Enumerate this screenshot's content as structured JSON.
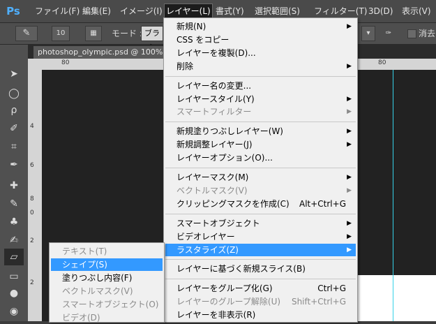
{
  "app": {
    "logo": "Ps"
  },
  "menubar": [
    {
      "label": "ファイル(F)",
      "left": 0
    },
    {
      "label": "編集(E)"
    },
    {
      "label": "イメージ(I)"
    },
    {
      "label": "レイヤー(L)",
      "active": true
    },
    {
      "label": "書式(Y)"
    },
    {
      "label": "選択範囲(S)"
    },
    {
      "label": "フィルター(T)"
    },
    {
      "label": "3D(D)"
    },
    {
      "label": "表示(V)"
    }
  ],
  "options": {
    "brush_size": "10",
    "mode_label": "モード :",
    "mode_value": "ブラシ",
    "erase_label": "消去"
  },
  "document_tab": {
    "title": "photoshop_olympic.psd @ 100%"
  },
  "ruler": {
    "h_left": "80",
    "h_right": "80",
    "v_marks": [
      "4",
      "6",
      "8",
      "0",
      "2",
      "2"
    ]
  },
  "layer_menu": [
    {
      "label": "新規(N)",
      "arrow": true
    },
    {
      "label": "CSS をコピー"
    },
    {
      "label": "レイヤーを複製(D)..."
    },
    {
      "label": "削除",
      "arrow": true
    },
    {
      "sep": true
    },
    {
      "label": "レイヤー名の変更..."
    },
    {
      "label": "レイヤースタイル(Y)",
      "arrow": true
    },
    {
      "label": "スマートフィルター",
      "disabled": true,
      "arrow": true
    },
    {
      "sep": true
    },
    {
      "label": "新規塗りつぶしレイヤー(W)",
      "arrow": true
    },
    {
      "label": "新規調整レイヤー(J)",
      "arrow": true
    },
    {
      "label": "レイヤーオプション(O)..."
    },
    {
      "sep": true
    },
    {
      "label": "レイヤーマスク(M)",
      "arrow": true
    },
    {
      "label": "ベクトルマスク(V)",
      "disabled": true,
      "arrow": true
    },
    {
      "label": "クリッピングマスクを作成(C)",
      "shortcut": "Alt+Ctrl+G"
    },
    {
      "sep": true
    },
    {
      "label": "スマートオブジェクト",
      "arrow": true
    },
    {
      "label": "ビデオレイヤー",
      "arrow": true
    },
    {
      "label": "ラスタライズ(Z)",
      "arrow": true,
      "highlighted": true
    },
    {
      "sep": true
    },
    {
      "label": "レイヤーに基づく新規スライス(B)"
    },
    {
      "sep": true
    },
    {
      "label": "レイヤーをグループ化(G)",
      "shortcut": "Ctrl+G"
    },
    {
      "label": "レイヤーのグループ解除(U)",
      "shortcut": "Shift+Ctrl+G",
      "disabled": true
    },
    {
      "label": "レイヤーを非表示(R)"
    }
  ],
  "rasterize_submenu": [
    {
      "label": "テキスト(T)",
      "disabled": true
    },
    {
      "label": "シェイプ(S)",
      "highlighted": true
    },
    {
      "label": "塗りつぶし内容(F)"
    },
    {
      "label": "ベクトルマスク(V)",
      "disabled": true
    },
    {
      "label": "スマートオブジェクト(O)",
      "disabled": true
    },
    {
      "label": "ビデオ(D)",
      "disabled": true
    }
  ]
}
